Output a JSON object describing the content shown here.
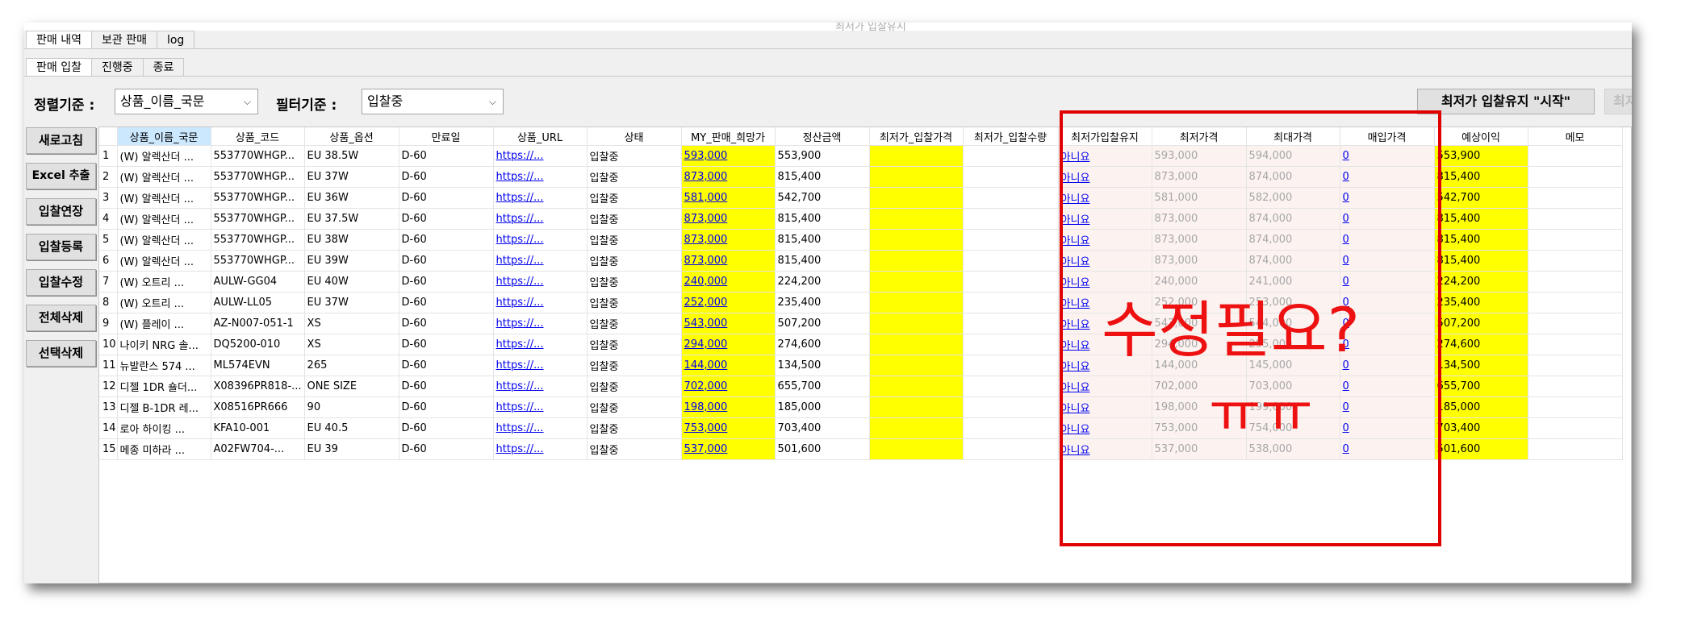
{
  "window": {
    "title": "최저가 입찰유지"
  },
  "main_tabs": [
    "판매 내역",
    "보관 판매",
    "log"
  ],
  "sub_tabs": [
    "판매 입찰",
    "진행중",
    "종료"
  ],
  "sort": {
    "label": "정렬기준 :",
    "value": "상품_이름_국문"
  },
  "filter": {
    "label": "필터기준 :",
    "value": "입찰중"
  },
  "top_buttons": {
    "start": "최저가 입찰유지 \"시작\"",
    "stop_partial": "최저"
  },
  "side_buttons": [
    "새로고침",
    "Excel 추출",
    "입찰연장",
    "입찰등록",
    "입찰수정",
    "전체삭제",
    "선택삭제"
  ],
  "columns": [
    "",
    "상품_이름_국문",
    "상품_코드",
    "상품_옵션",
    "만료일",
    "상품_URL",
    "상태",
    "MY_판매_희망가",
    "정산금액",
    "최저가_입찰가격",
    "최저가_입찰수량",
    "최저가입찰유지",
    "최저가격",
    "최대가격",
    "매입가격",
    "예상이익",
    "메모"
  ],
  "rows": [
    [
      "1",
      "(W) 알렉산더 ...",
      "553770WHGP...",
      "EU 38.5W",
      "D-60",
      "https://...",
      "입찰중",
      "593,000",
      "553,900",
      "",
      "",
      "아니요",
      "593,000",
      "594,000",
      "0",
      "553,900",
      ""
    ],
    [
      "2",
      "(W) 알렉산더 ...",
      "553770WHGP...",
      "EU 37W",
      "D-60",
      "https://...",
      "입찰중",
      "873,000",
      "815,400",
      "",
      "",
      "아니요",
      "873,000",
      "874,000",
      "0",
      "815,400",
      ""
    ],
    [
      "3",
      "(W) 알렉산더 ...",
      "553770WHGP...",
      "EU 36W",
      "D-60",
      "https://...",
      "입찰중",
      "581,000",
      "542,700",
      "",
      "",
      "아니요",
      "581,000",
      "582,000",
      "0",
      "542,700",
      ""
    ],
    [
      "4",
      "(W) 알렉산더 ...",
      "553770WHGP...",
      "EU 37.5W",
      "D-60",
      "https://...",
      "입찰중",
      "873,000",
      "815,400",
      "",
      "",
      "아니요",
      "873,000",
      "874,000",
      "0",
      "815,400",
      ""
    ],
    [
      "5",
      "(W) 알렉산더 ...",
      "553770WHGP...",
      "EU 38W",
      "D-60",
      "https://...",
      "입찰중",
      "873,000",
      "815,400",
      "",
      "",
      "아니요",
      "873,000",
      "874,000",
      "0",
      "815,400",
      ""
    ],
    [
      "6",
      "(W) 알렉산더 ...",
      "553770WHGP...",
      "EU 39W",
      "D-60",
      "https://...",
      "입찰중",
      "873,000",
      "815,400",
      "",
      "",
      "아니요",
      "873,000",
      "874,000",
      "0",
      "815,400",
      ""
    ],
    [
      "7",
      "(W) 오트리 ...",
      "AULW-GG04",
      "EU 40W",
      "D-60",
      "https://...",
      "입찰중",
      "240,000",
      "224,200",
      "",
      "",
      "아니요",
      "240,000",
      "241,000",
      "0",
      "224,200",
      ""
    ],
    [
      "8",
      "(W) 오트리 ...",
      "AULW-LL05",
      "EU 37W",
      "D-60",
      "https://...",
      "입찰중",
      "252,000",
      "235,400",
      "",
      "",
      "아니요",
      "252,000",
      "253,000",
      "0",
      "235,400",
      ""
    ],
    [
      "9",
      "(W) 플레이 ...",
      "AZ-N007-051-1",
      "XS",
      "D-60",
      "https://...",
      "입찰중",
      "543,000",
      "507,200",
      "",
      "",
      "아니요",
      "543,000",
      "544,000",
      "0",
      "507,200",
      ""
    ],
    [
      "10",
      "나이키 NRG 솔...",
      "DQ5200-010",
      "XS",
      "D-60",
      "https://...",
      "입찰중",
      "294,000",
      "274,600",
      "",
      "",
      "아니요",
      "294,000",
      "295,000",
      "0",
      "274,600",
      ""
    ],
    [
      "11",
      "뉴발란스 574 ...",
      "ML574EVN",
      "265",
      "D-60",
      "https://...",
      "입찰중",
      "144,000",
      "134,500",
      "",
      "",
      "아니요",
      "144,000",
      "145,000",
      "0",
      "134,500",
      ""
    ],
    [
      "12",
      "디젤 1DR 숄더...",
      "X08396PR818-...",
      "ONE SIZE",
      "D-60",
      "https://...",
      "입찰중",
      "702,000",
      "655,700",
      "",
      "",
      "아니요",
      "702,000",
      "703,000",
      "0",
      "655,700",
      ""
    ],
    [
      "13",
      "디젤 B-1DR 레...",
      "X08516PR666",
      "90",
      "D-60",
      "https://...",
      "입찰중",
      "198,000",
      "185,000",
      "",
      "",
      "아니요",
      "198,000",
      "199,000",
      "0",
      "185,000",
      ""
    ],
    [
      "14",
      "로아 하이킹 ...",
      "KFA10-001",
      "EU 40.5",
      "D-60",
      "https://...",
      "입찰중",
      "753,000",
      "703,400",
      "",
      "",
      "아니요",
      "753,000",
      "754,000",
      "0",
      "703,400",
      ""
    ],
    [
      "15",
      "메종 미하라 ...",
      "A02FW704-...",
      "EU 39",
      "D-60",
      "https://...",
      "입찰중",
      "537,000",
      "501,600",
      "",
      "",
      "아니요",
      "537,000",
      "538,000",
      "0",
      "501,600",
      ""
    ]
  ],
  "annotation": {
    "line1": "수정필요?",
    "line2": "ㅠㅠ",
    "color": "#e10000"
  },
  "colors": {
    "highlight_yellow": "#ffff00",
    "maintain_bg": "#fcf3f1",
    "link_blue": "#0000ee",
    "header_selected": "#cce8ff"
  }
}
